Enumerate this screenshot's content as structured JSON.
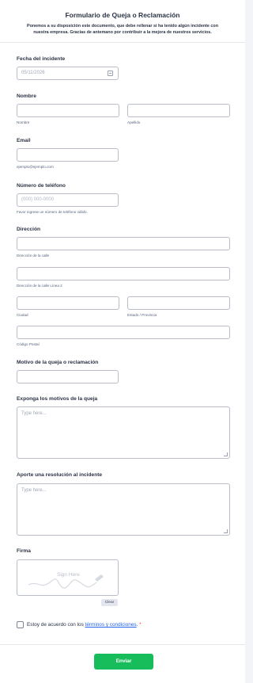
{
  "header": {
    "title": "Formulario de Queja o Reclamación",
    "subtitle": "Ponemos a su disposición este documento, que debe rellenar si ha tenido algún incidente con nuestra empresa. Gracias de antemano por contribuir a la mejora de nuestros servicios."
  },
  "fecha": {
    "label": "Fecha del incidente",
    "value": "05/11/2026",
    "icon": "calendar-icon"
  },
  "nombre": {
    "label": "Nombre",
    "first_sublabel": "Nombre",
    "last_sublabel": "Apellido",
    "first_value": "",
    "last_value": ""
  },
  "email": {
    "label": "Email",
    "value": "",
    "sublabel": "ejemplo@ejemplo.com"
  },
  "telefono": {
    "label": "Número de teléfono",
    "placeholder": "(000) 000-0000",
    "sublabel": "Favor ingrese un número de teléfono válido."
  },
  "direccion": {
    "label": "Dirección",
    "street_sublabel": "Dirección de la calle",
    "street2_sublabel": "Dirección de la calle Línea 2",
    "city_sublabel": "Ciudad",
    "state_sublabel": "Estado / Provincia",
    "zip_sublabel": "Código Postal"
  },
  "motivo": {
    "label": "Motivo de la queja o reclamación",
    "value": ""
  },
  "exponga": {
    "label": "Exponga los motivos de la queja",
    "placeholder": "Type here..."
  },
  "resolucion": {
    "label": "Aporte una resolución al incidente",
    "placeholder": "Type here..."
  },
  "firma": {
    "label": "Firma",
    "placeholder": "Sign Here",
    "clear_label": "Clear"
  },
  "terminos": {
    "prefix": "Estoy de acuerdo con los ",
    "link": "términos y condiciones",
    "suffix": ".",
    "required_mark": "*"
  },
  "submit_label": "Enviar",
  "colors": {
    "submit": "#18bd5b",
    "link": "#2563eb",
    "required": "#f23a3c"
  }
}
